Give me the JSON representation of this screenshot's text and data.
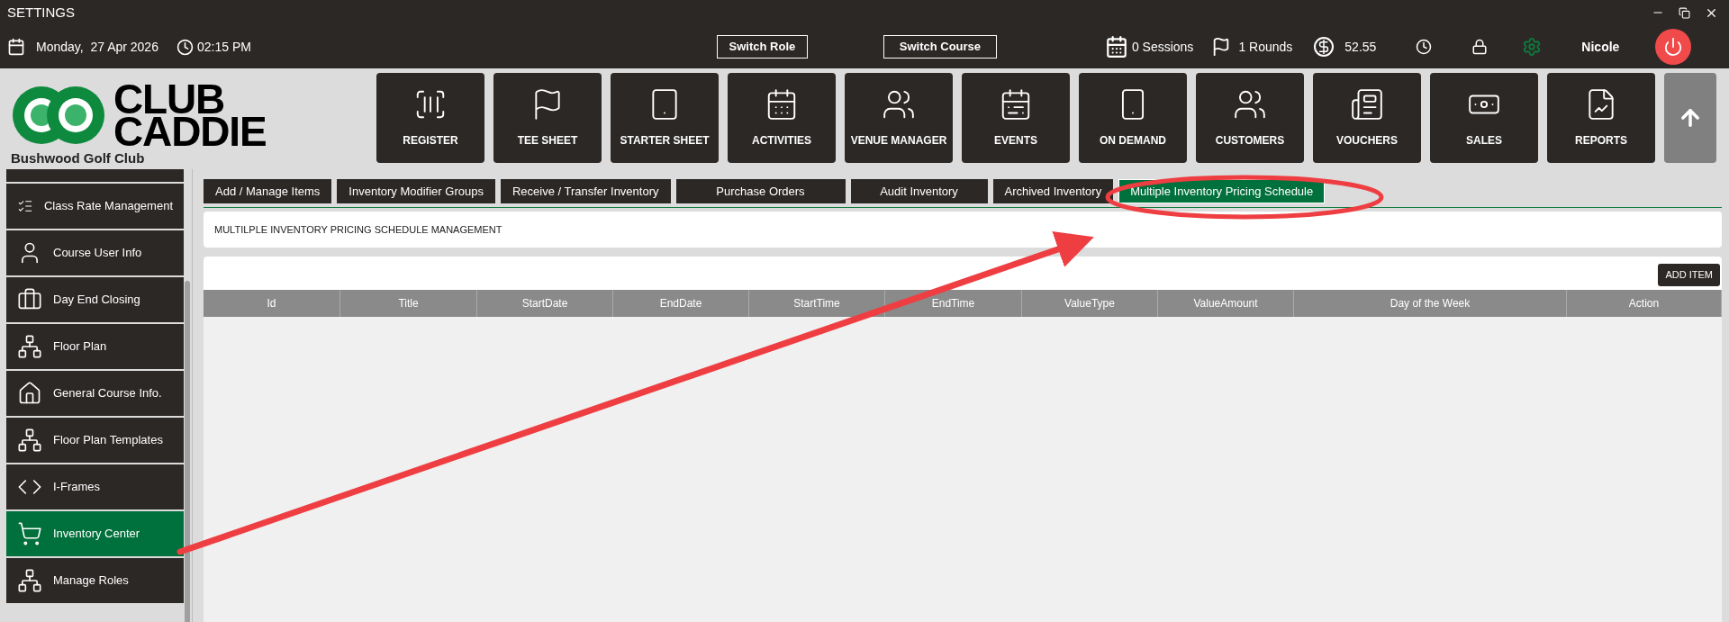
{
  "window": {
    "title": "SETTINGS"
  },
  "top_bar": {
    "date": "Monday,  27 Apr 2026",
    "time": "02:15 PM",
    "buttons": [
      "Switch Role",
      "Switch Course"
    ],
    "sessions": "0 Sessions",
    "rounds": "1 Rounds",
    "balance": "52.55",
    "user": "Nicole"
  },
  "brand": {
    "logo_line1": "CLUB",
    "logo_line2": "CADDIE",
    "club": "Bushwood Golf Club"
  },
  "nav": [
    {
      "label": "REGISTER",
      "kind": "scanner"
    },
    {
      "label": "TEE SHEET",
      "kind": "flag"
    },
    {
      "label": "STARTER SHEET",
      "kind": "tablet"
    },
    {
      "label": "ACTIVITIES",
      "kind": "calendar"
    },
    {
      "label": "VENUE MANAGER",
      "kind": "meeting"
    },
    {
      "label": "EVENTS",
      "kind": "events"
    },
    {
      "label": "ON DEMAND",
      "kind": "phone"
    },
    {
      "label": "CUSTOMERS",
      "kind": "people"
    },
    {
      "label": "VOUCHERS",
      "kind": "newspaper"
    },
    {
      "label": "SALES",
      "kind": "money"
    },
    {
      "label": "REPORTS",
      "kind": "report"
    }
  ],
  "sidebar": {
    "items": [
      {
        "label": "Class Rate Management",
        "kind": "list",
        "selected": false
      },
      {
        "label": "Course User Info",
        "kind": "user",
        "selected": false
      },
      {
        "label": "Day End Closing",
        "kind": "case",
        "selected": false
      },
      {
        "label": "Floor Plan",
        "kind": "org",
        "selected": false
      },
      {
        "label": "General Course Info.",
        "kind": "home",
        "selected": false
      },
      {
        "label": "Floor Plan Templates",
        "kind": "org",
        "selected": false
      },
      {
        "label": "I-Frames",
        "kind": "code",
        "selected": false
      },
      {
        "label": "Inventory Center",
        "kind": "cart",
        "selected": true
      },
      {
        "label": "Manage Roles",
        "kind": "org",
        "selected": false
      }
    ]
  },
  "tabs": [
    {
      "label": "Add / Manage Items",
      "selected": false
    },
    {
      "label": "Inventory Modifier Groups",
      "selected": false
    },
    {
      "label": "Receive / Transfer Inventory",
      "selected": false
    },
    {
      "label": "Purchase Orders",
      "selected": false
    },
    {
      "label": "Audit Inventory",
      "selected": false
    },
    {
      "label": "Archived Inventory",
      "selected": false
    },
    {
      "label": "Multiple Inventory Pricing Schedule",
      "selected": true
    }
  ],
  "section_title": "MULTILPLE INVENTORY PRICING SCHEDULE MANAGEMENT",
  "add_button": "ADD ITEM",
  "table": {
    "columns": [
      "Id",
      "Title",
      "StartDate",
      "EndDate",
      "StartTime",
      "EndTime",
      "ValueType",
      "ValueAmount",
      "Day of the Week",
      "Action"
    ]
  }
}
